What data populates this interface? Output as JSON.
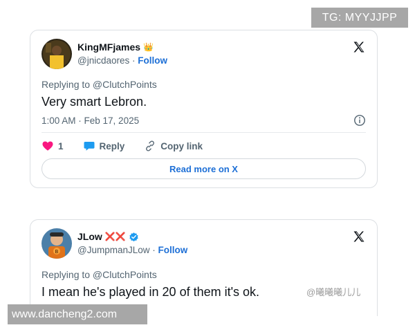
{
  "overlay": {
    "tg_label": "TG: MYYJJPP",
    "site_url": "www.dancheng2.com",
    "watermark": "@曦曦曦儿儿"
  },
  "tweet1": {
    "name": "KingMFjames",
    "name_emoji": "👑",
    "handle": "@jnicdaores",
    "separator": "·",
    "follow_label": "Follow",
    "replying_to": "Replying to @ClutchPoints",
    "text": "Very smart Lebron.",
    "timestamp": "1:00 AM · Feb 17, 2025",
    "like_count": "1",
    "reply_label": "Reply",
    "copy_link_label": "Copy link",
    "read_more_label": "Read more on X"
  },
  "tweet2": {
    "name": "JLow",
    "name_emoji": "❌❌",
    "handle": "@JumpmanJLow",
    "separator": "·",
    "follow_label": "Follow",
    "replying_to": "Replying to @ClutchPoints",
    "text": "I mean he's played in 20 of them it's ok."
  },
  "colors": {
    "link_blue": "#1d6fd6",
    "heart_pink": "#f91880",
    "reply_blue": "#1d9bf0",
    "verified_blue": "#1d9bf0"
  },
  "icons": [
    "x-logo-icon",
    "crown-emoji",
    "info-icon",
    "heart-icon",
    "reply-bubble-icon",
    "link-icon",
    "cross-mark-emoji",
    "verified-badge-icon"
  ]
}
